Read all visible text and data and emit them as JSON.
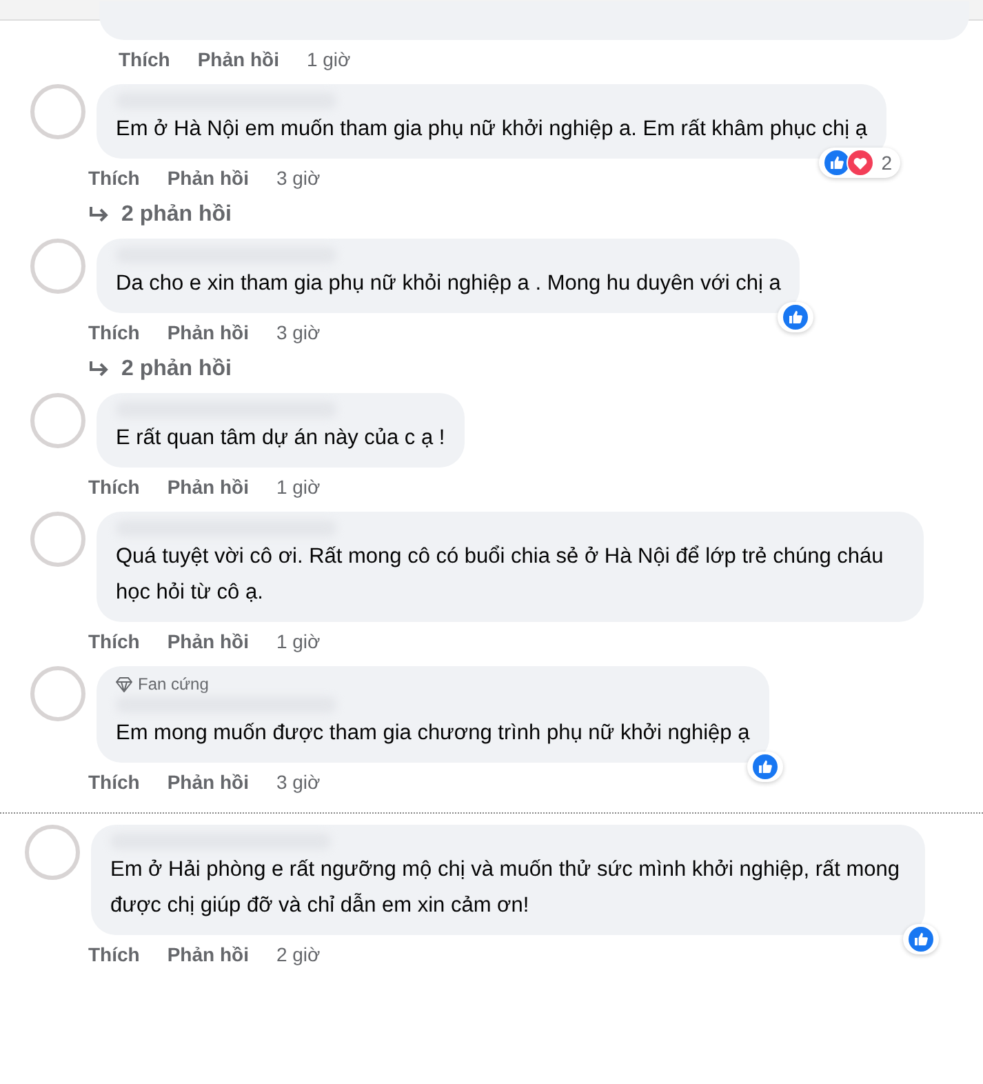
{
  "top_comment": {
    "like_label": "Thích",
    "reply_label": "Phản hồi",
    "time": "1 giờ"
  },
  "comments": [
    {
      "separator_before": false,
      "text": "Em ở Hà Nội em muốn tham gia phụ nữ khởi nghiệp a. Em rất khâm phục chị ạ",
      "reactions": [
        {
          "kind": "like"
        },
        {
          "kind": "love"
        }
      ],
      "reaction_count": "2",
      "like_label": "Thích",
      "reply_label": "Phản hồi",
      "time": "3 giờ",
      "replies_link": "2 phản hồi"
    },
    {
      "separator_before": false,
      "text": "Da cho e xin tham gia phụ nữ khỏi nghiệp a . Mong hu duyên với chị a",
      "reactions": [
        {
          "kind": "like"
        }
      ],
      "like_label": "Thích",
      "reply_label": "Phản hồi",
      "time": "3 giờ",
      "replies_link": "2 phản hồi"
    },
    {
      "separator_before": false,
      "text": "E rất quan tâm dự án này của c ạ !",
      "like_label": "Thích",
      "reply_label": "Phản hồi",
      "time": "1 giờ"
    },
    {
      "separator_before": false,
      "text": "Quá tuyệt vời cô ơi. Rất mong cô có buổi chia sẻ ở Hà Nội để lớp trẻ chúng cháu học hỏi từ cô ạ.",
      "like_label": "Thích",
      "reply_label": "Phản hồi",
      "time": "1 giờ"
    },
    {
      "separator_before": false,
      "badge": "Fan cứng",
      "text": "Em mong muốn được tham gia chương trình phụ nữ khởi nghiệp ạ",
      "reactions": [
        {
          "kind": "like"
        }
      ],
      "like_label": "Thích",
      "reply_label": "Phản hồi",
      "time": "3 giờ"
    },
    {
      "separator_before": true,
      "text": "Em ở Hải phòng e rất ngưỡng mộ chị và muốn thử sức mình khởi nghiệp, rất mong được chị giúp đỡ và chỉ dẫn em xin cảm ơn!",
      "reactions": [
        {
          "kind": "like"
        }
      ],
      "like_label": "Thích",
      "reply_label": "Phản hồi",
      "time": "2 giờ"
    }
  ]
}
